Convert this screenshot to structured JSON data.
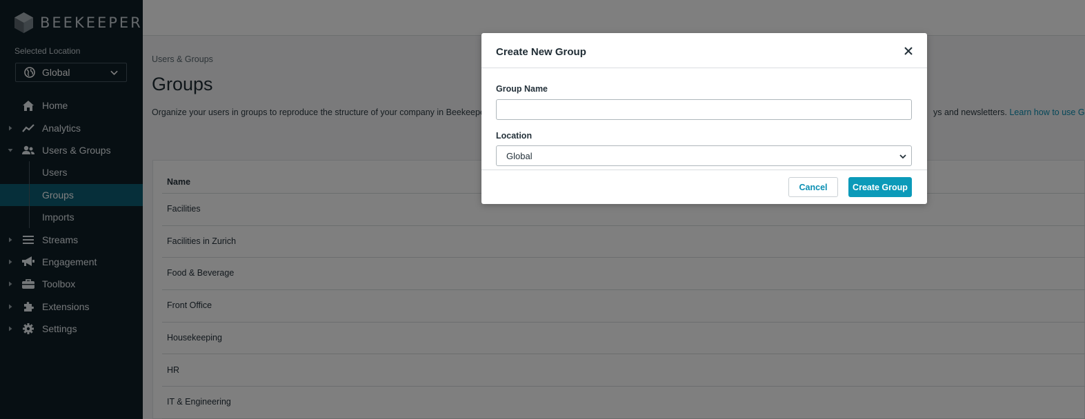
{
  "app": {
    "brand": "BEEKEEPER"
  },
  "sidebar": {
    "location_label": "Selected Location",
    "location_value": "Global",
    "items": [
      {
        "label": "Home",
        "icon": "home-icon",
        "expandable": false
      },
      {
        "label": "Analytics",
        "icon": "analytics-icon",
        "expandable": true
      },
      {
        "label": "Users & Groups",
        "icon": "users-icon",
        "expandable": true,
        "expanded": true,
        "children": [
          {
            "label": "Users"
          },
          {
            "label": "Groups",
            "active": true
          },
          {
            "label": "Imports"
          }
        ]
      },
      {
        "label": "Streams",
        "icon": "streams-icon",
        "expandable": true
      },
      {
        "label": "Engagement",
        "icon": "megaphone-icon",
        "expandable": true
      },
      {
        "label": "Toolbox",
        "icon": "toolbox-icon",
        "expandable": true
      },
      {
        "label": "Extensions",
        "icon": "puzzle-icon",
        "expandable": true
      },
      {
        "label": "Settings",
        "icon": "gear-icon",
        "expandable": true
      }
    ]
  },
  "main": {
    "breadcrumb": "Users & Groups",
    "title": "Groups",
    "description_start": "Organize your users in groups to reproduce the structure of your company in Beekeeper t",
    "description_end": "ys and newsletters.",
    "learn_link": "Learn how to use Grou",
    "table": {
      "header_name": "Name",
      "rows": [
        "Facilities",
        "Facilities in Zurich",
        "Food & Beverage",
        "Front Office",
        "Housekeeping",
        "HR",
        "IT & Engineering"
      ]
    }
  },
  "modal": {
    "title": "Create New Group",
    "group_name_label": "Group Name",
    "group_name_value": "",
    "location_label": "Location",
    "location_value": "Global",
    "cancel_label": "Cancel",
    "create_label": "Create Group"
  },
  "colors": {
    "sidebar_bg": "#0f1e27",
    "active_item_bg": "#0d5f74",
    "accent": "#0b9ab9",
    "link": "#0a8fb3"
  }
}
